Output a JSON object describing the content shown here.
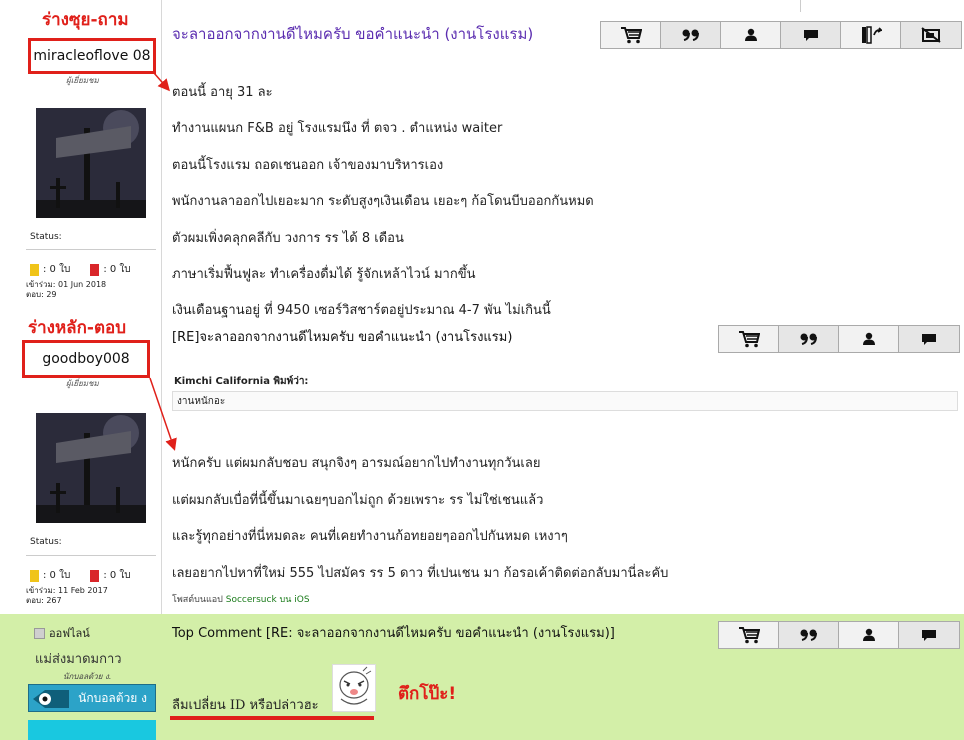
{
  "annotations": {
    "question_account_label": "ร่างซุย-ถาม",
    "answer_account_label": "ร่างหลัก-ตอบ",
    "sticker_caption": "ตึกโป๊ะ!"
  },
  "post1": {
    "username": "miracleoflove 08",
    "rank": "ผู้เยี่ยมชม",
    "status_label": "Status:",
    "yellow_cards": ": 0 ใบ",
    "red_cards": ": 0 ใบ",
    "joined": "เข้าร่วม: 01 Jun 2018",
    "posts": "ตอบ: 29",
    "title": "จะลาออกจากงานดีไหมครับ ขอคำแนะนำ (งานโรงแรม)",
    "lines": [
      "ตอนนี้ อายุ 31 ละ",
      "ทำงานแผนก F&B อยู่ โรงแรมนึง ที่ ตจว . ตำแหน่ง waiter",
      "ตอนนี้โรงแรม ถอดเชนออก เจ้าของมาบริหารเอง",
      "พนักงานลาออกไปเยอะมาก ระดับสูงๆเงินเดือน เยอะๆ ก้อโดนบีบออกกันหมด",
      "ตัวผมเพิ่งคลุกคลีกับ วงการ รร ได้ 8 เดือน",
      "ภาษาเริ่มฟื้นฟูละ ทำเครื่องดื่มได้ รู้จักเหล้าไวน์ มากขึ้น",
      "เงินเดือนฐานอยู่ ที่ 9450 เซอร์วิสชาร์ตอยู่ประมาณ 4-7 พัน ไม่เกินนี้"
    ]
  },
  "post2": {
    "username": "goodboy008",
    "rank": "ผู้เยี่ยมชม",
    "status_label": "Status:",
    "yellow_cards": ": 0 ใบ",
    "red_cards": ": 0 ใบ",
    "joined": "เข้าร่วม: 11 Feb 2017",
    "posts": "ตอบ: 267",
    "title": "[RE]จะลาออกจากงานดีไหมครับ ขอคำแนะนำ (งานโรงแรม)",
    "quote_author": "Kimchi California พิมพ์ว่า:",
    "quote_text": "งานหนักอะ",
    "lines": [
      "หนักครับ แต่ผมกลับชอบ สนุกจิงๆ อารมณ์อยากไปทำงานทุกวันเลย",
      "แต่ผมกลับเบื่อที่นี้ขึ้นมาเฉยๆบอกไม่ถูก ด้วยเพราะ รร ไม่ใช่เชนแล้ว",
      "และรู้ทุกอย่างที่นี่หมดละ คนที่เคยทำงานก้อทยอยๆออกไปกันหมด เหงาๆ",
      "เลยอยากไปหาที่ใหม่ 555 ไปสมัคร รร 5 ดาว ที่เปนเชน มา ก้อรอเค้าติดต่อกลับมานี่ละคับ"
    ],
    "via_prefix": "โพสต์บนแอป",
    "via_app": "Soccersuck บน iOS"
  },
  "top_comment": {
    "online_label": "ออฟไลน์",
    "username": "แม่ส่งมาดมกาว",
    "subtitle": "นักบอลด้วย ง.",
    "rank_button": "นักบอลต้วย ง",
    "title": "Top Comment [RE: จะลาออกจากงานดีไหมครับ ขอคำแนะนำ (งานโรงแรม)]",
    "text": "ลืมเปลี่ยน ID หรือปล่าวฮะ"
  },
  "toolbar_icons": [
    "cart-icon",
    "quote-icon",
    "user-icon",
    "message-icon",
    "door-exit-icon",
    "hide-icon"
  ],
  "colors": {
    "annotation_red": "#e0201a",
    "title_purple": "#5b2db0",
    "top_comment_green": "#d3efa8"
  }
}
